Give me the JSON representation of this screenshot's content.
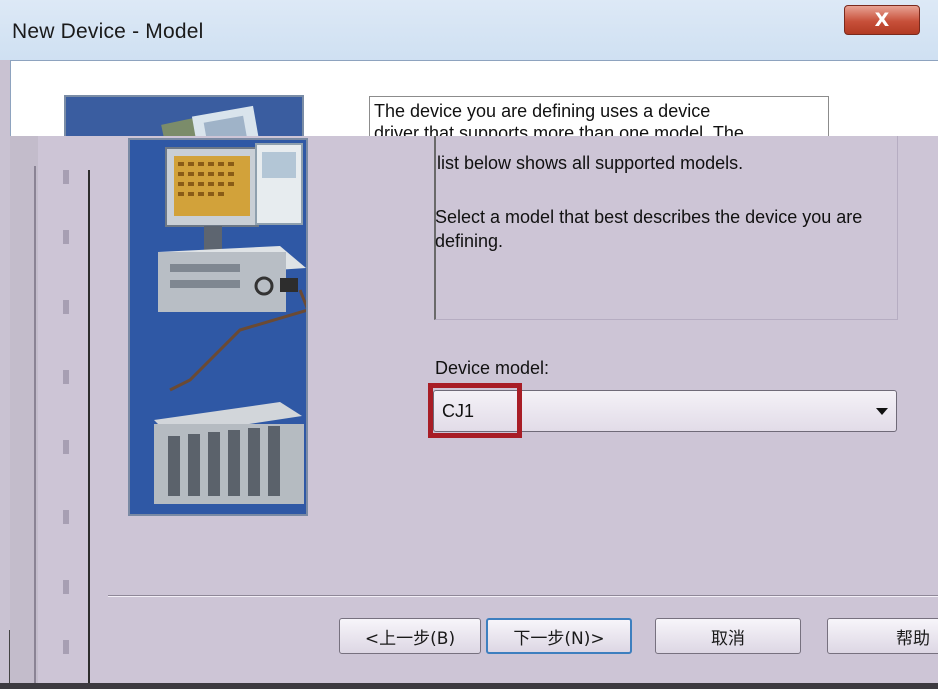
{
  "window": {
    "title": "New Device - Model",
    "close_label": "X"
  },
  "description": {
    "upper_line1": "The device you are defining uses a device",
    "upper_line2": "driver that supports more than one model.  The",
    "line_visible": "list below shows all supported models.",
    "paragraph2": "Select  a model that best describes the device you are defining."
  },
  "model": {
    "label": "Device model:",
    "selected": "CJ1",
    "highlight_color": "#a81d26"
  },
  "buttons": {
    "back": "<上一步(B)",
    "next": "下一步(N)>",
    "cancel": "取消",
    "help": "帮助"
  },
  "icons": {
    "close": "close-icon",
    "dropdown": "chevron-down-icon",
    "illustration": "computer-plc-illustration"
  }
}
